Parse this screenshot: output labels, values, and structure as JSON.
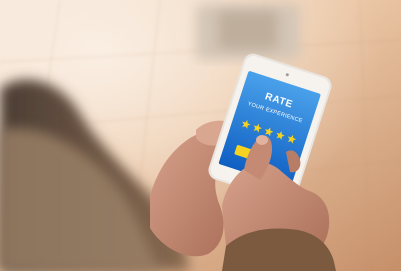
{
  "photo": {
    "screen": {
      "title": "RATE",
      "subtitle": "YOUR EXPERIENCE",
      "rating": {
        "value": 5,
        "max": 5
      }
    },
    "colors": {
      "floor_light": "#f1dcc6",
      "floor_dark": "#c99774",
      "screen_blue_top": "#4aa1ea",
      "screen_blue_bottom": "#0f5fc3",
      "star_yellow": "#f6d321",
      "sleeve_brown": "#7b5a3f",
      "skin": "#c9907a"
    }
  }
}
